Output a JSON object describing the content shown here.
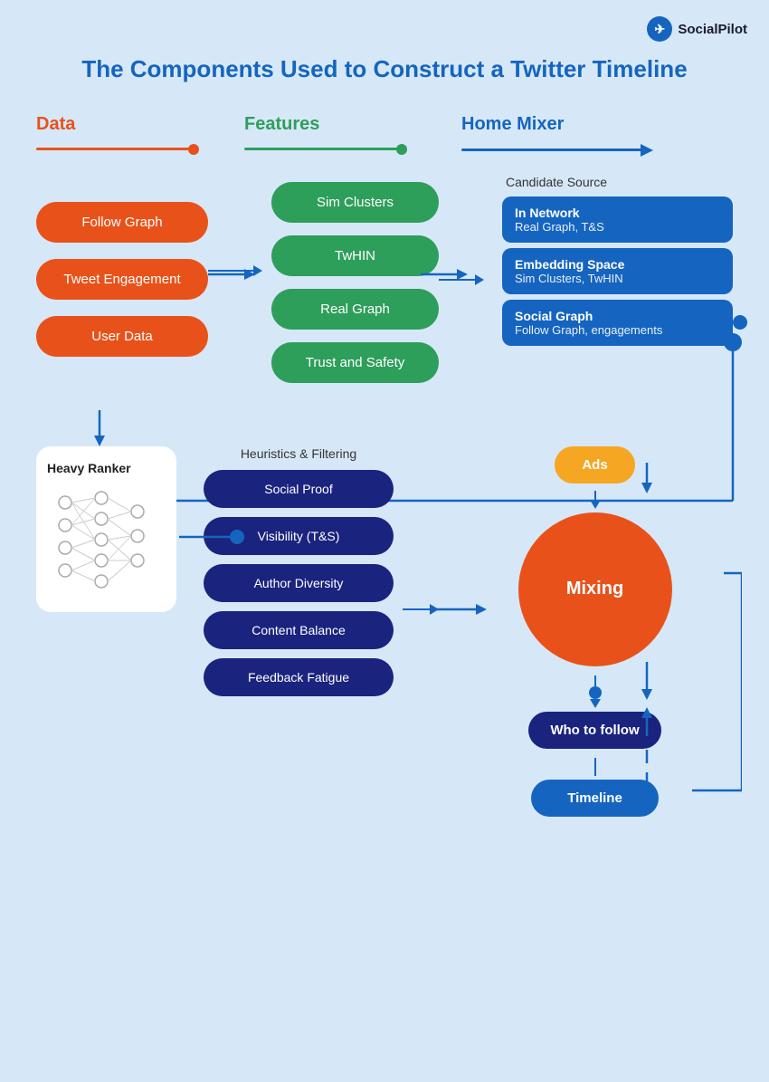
{
  "logo": {
    "name": "SocialPilot",
    "icon": "✈"
  },
  "title": "The Components Used to Construct a Twitter Timeline",
  "flow": {
    "data_label": "Data",
    "features_label": "Features",
    "home_mixer_label": "Home Mixer"
  },
  "data_pills": [
    "Follow Graph",
    "Tweet Engagement",
    "User Data"
  ],
  "features_pills": [
    "Sim Clusters",
    "TwHIN",
    "Real Graph",
    "Trust and Safety"
  ],
  "candidate_source_label": "Candidate Source",
  "candidate_groups": [
    {
      "title": "In Network",
      "sub": ""
    },
    {
      "title": "Real Graph, T&S",
      "sub": ""
    },
    {
      "title": "Embedding Space",
      "sub": ""
    },
    {
      "title": "Sim Clusters, TwHIN",
      "sub": ""
    },
    {
      "title": "Social Graph",
      "sub": ""
    },
    {
      "title": "Follow Graph, engagements",
      "sub": ""
    }
  ],
  "heavy_ranker": {
    "title": "Heavy Ranker"
  },
  "heuristics_label": "Heuristics & Filtering",
  "heuristics_pills": [
    "Social Proof",
    "Visibility (T&S)",
    "Author Diversity",
    "Content Balance",
    "Feedback Fatigue"
  ],
  "ads_label": "Ads",
  "mixing_label": "Mixing",
  "who_to_follow_label": "Who to follow",
  "timeline_label": "Timeline"
}
